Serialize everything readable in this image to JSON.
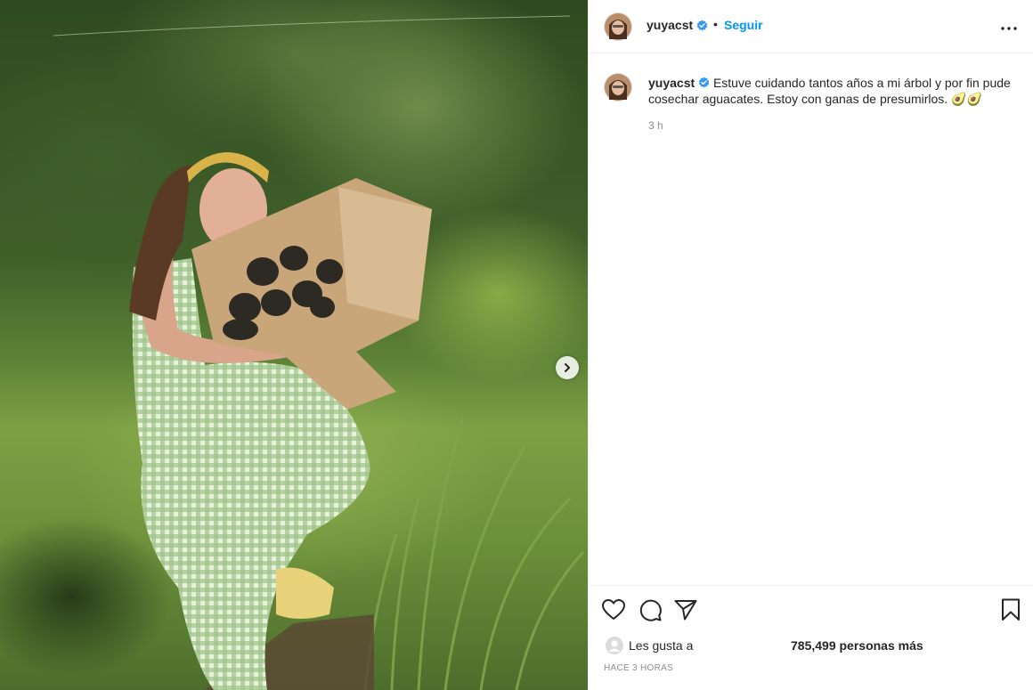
{
  "post": {
    "image_alt": "Woman in green gingham dress hugging a cardboard box of avocados in a garden",
    "next_icon": "chevron-right-icon"
  },
  "header": {
    "username": "yuyacst",
    "verified_icon": "verified-badge-icon",
    "separator": "•",
    "follow_label": "Seguir",
    "more_icon": "more-horizontal-icon"
  },
  "caption": {
    "username": "yuyacst",
    "text": "Estuve cuidando tantos años a mi árbol y por fin pude cosechar aguacates. Estoy con ganas de presumirlos. 🥑🥑",
    "time": "3 h"
  },
  "actions": {
    "like_icon": "heart-icon",
    "comment_icon": "comment-icon",
    "share_icon": "paper-plane-icon",
    "save_icon": "bookmark-icon"
  },
  "likes": {
    "prefix": "Les gusta a",
    "count_text": "785,499 personas más"
  },
  "timestamp": "HACE 3 HORAS",
  "colors": {
    "link_blue": "#0095f6",
    "verified_blue": "#3897f0",
    "text_primary": "#262626",
    "text_secondary": "#8e8e8e",
    "border": "#efefef"
  }
}
